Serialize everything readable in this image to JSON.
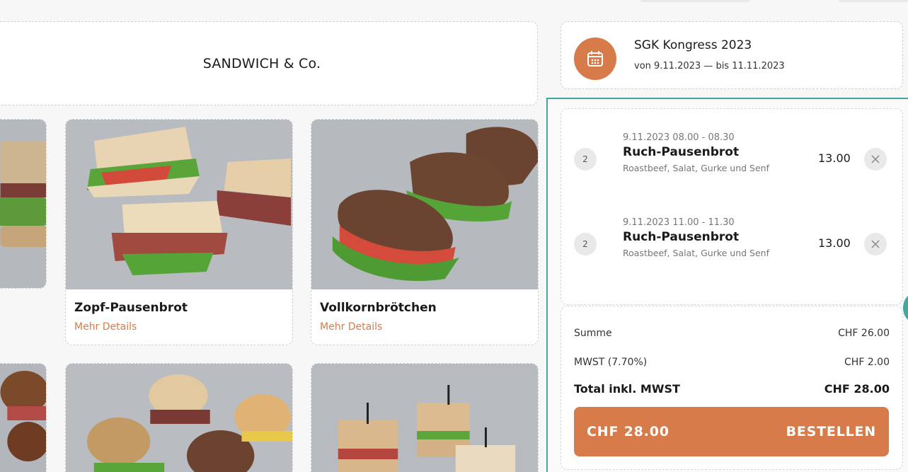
{
  "store": {
    "title": "SANDWICH & Co."
  },
  "products": [
    {
      "name": "Zopf-Pausenbrot",
      "details_link": "Mehr Details"
    },
    {
      "name": "Vollkornbrötchen",
      "details_link": "Mehr Details"
    }
  ],
  "event": {
    "icon": "calendar-icon",
    "title": "SGK Kongress 2023",
    "dates": "von 9.11.2023 — bis 11.11.2023"
  },
  "cart": {
    "items": [
      {
        "time": "9.11.2023 08.00 - 08.30",
        "qty": "2",
        "name": "Ruch-Pausenbrot",
        "desc": "Roastbeef, Salat, Gurke und Senf",
        "price": "13.00"
      },
      {
        "time": "9.11.2023 11.00 - 11.30",
        "qty": "2",
        "name": "Ruch-Pausenbrot",
        "desc": "Roastbeef, Salat, Gurke und Senf",
        "price": "13.00"
      }
    ],
    "summary": {
      "sum_label": "Summe",
      "sum_value": "CHF 26.00",
      "vat_label": "MWST (7.70%)",
      "vat_value": "CHF 2.00",
      "total_label": "Total inkl. MWST",
      "total_value": "CHF 28.00"
    },
    "order_button": {
      "amount": "CHF 28.00",
      "label": "BESTELLEN"
    }
  },
  "colors": {
    "accent": "#d77b4a",
    "teal": "#3ea99f"
  }
}
